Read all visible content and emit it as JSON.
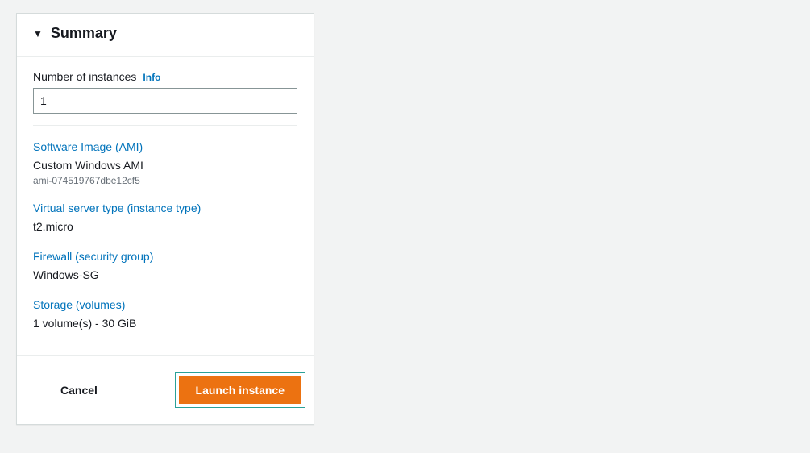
{
  "summary": {
    "title": "Summary",
    "num_instances_label": "Number of instances",
    "info_label": "Info",
    "num_instances_value": "1",
    "ami": {
      "link_label": "Software Image (AMI)",
      "name": "Custom Windows AMI",
      "id": "ami-074519767dbe12cf5"
    },
    "instance_type": {
      "link_label": "Virtual server type (instance type)",
      "value": "t2.micro"
    },
    "security_group": {
      "link_label": "Firewall (security group)",
      "value": "Windows-SG"
    },
    "storage": {
      "link_label": "Storage (volumes)",
      "value": "1 volume(s) - 30 GiB"
    }
  },
  "footer": {
    "cancel_label": "Cancel",
    "launch_label": "Launch instance"
  }
}
